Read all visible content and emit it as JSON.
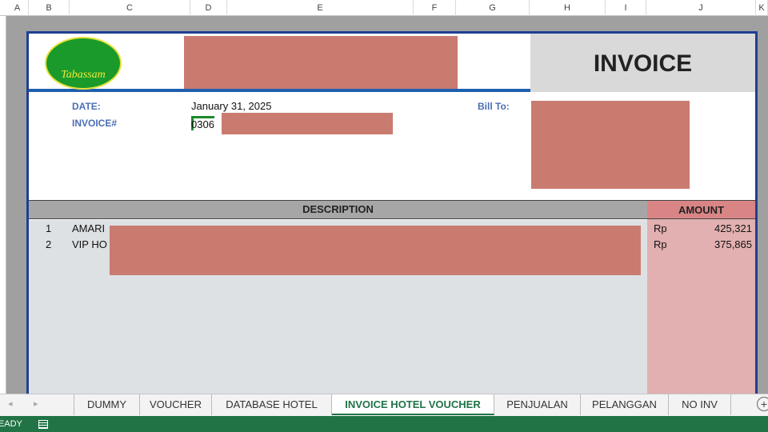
{
  "columns": [
    "A",
    "B",
    "C",
    "D",
    "E",
    "F",
    "G",
    "H",
    "I",
    "J",
    "K"
  ],
  "invoice": {
    "logo_text": "Tabassam",
    "title": "INVOICE",
    "date_label": "DATE:",
    "date_value": "January 31, 2025",
    "invoice_label": "INVOICE#",
    "invoice_value": "0306",
    "bill_to_label": "Bill To:",
    "description_header": "DESCRIPTION",
    "amount_header": "AMOUNT",
    "items": [
      {
        "no": "1",
        "desc": "AMARI",
        "currency": "Rp",
        "amount": "425,321"
      },
      {
        "no": "2",
        "desc": "VIP HO",
        "currency": "Rp",
        "amount": "375,865"
      }
    ]
  },
  "sheet_tabs": [
    "DUMMY",
    "VOUCHER",
    "DATABASE HOTEL",
    "INVOICE HOTEL VOUCHER",
    "PENJUALAN",
    "PELANGGAN",
    "NO INV"
  ],
  "active_tab": "INVOICE HOTEL VOUCHER",
  "status": {
    "text": "READY"
  }
}
